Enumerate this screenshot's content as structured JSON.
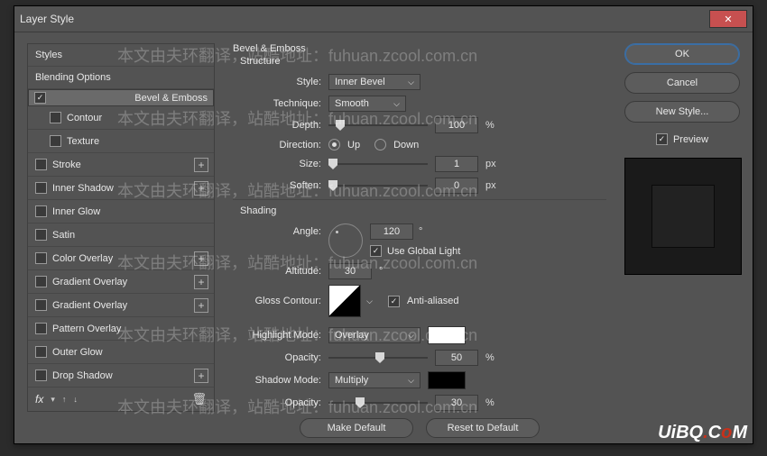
{
  "window": {
    "title": "Layer Style"
  },
  "styles": {
    "header": "Styles",
    "blending": "Blending Options",
    "bevel": "Bevel & Emboss",
    "contour": "Contour",
    "texture": "Texture",
    "stroke": "Stroke",
    "innerShadow": "Inner Shadow",
    "innerGlow": "Inner Glow",
    "satin": "Satin",
    "colorOverlay": "Color Overlay",
    "gradientOverlay": "Gradient Overlay",
    "gradientOverlay2": "Gradient Overlay",
    "patternOverlay": "Pattern Overlay",
    "outerGlow": "Outer Glow",
    "dropShadow": "Drop Shadow",
    "fx": "fx"
  },
  "panel": {
    "title": "Bevel & Emboss",
    "structure": "Structure",
    "styleLbl": "Style:",
    "styleVal": "Inner Bevel",
    "techLbl": "Technique:",
    "techVal": "Smooth",
    "depthLbl": "Depth:",
    "depthVal": "100",
    "pct": "%",
    "dirLbl": "Direction:",
    "up": "Up",
    "down": "Down",
    "sizeLbl": "Size:",
    "sizeVal": "1",
    "px": "px",
    "softenLbl": "Soften:",
    "softenVal": "0",
    "shading": "Shading",
    "angleLbl": "Angle:",
    "angleVal": "120",
    "deg": "°",
    "globalLight": "Use Global Light",
    "altLbl": "Altitude:",
    "altVal": "30",
    "glossLbl": "Gloss Contour:",
    "aa": "Anti-aliased",
    "hlModeLbl": "Highlight Mode:",
    "hlModeVal": "Overlay",
    "hlColor": "#ffffff",
    "opacityLbl": "Opacity:",
    "hlOpacity": "50",
    "shModeLbl": "Shadow Mode:",
    "shModeVal": "Multiply",
    "shColor": "#000000",
    "shOpacity": "30",
    "makeDefault": "Make Default",
    "resetDefault": "Reset to Default"
  },
  "right": {
    "ok": "OK",
    "cancel": "Cancel",
    "newStyle": "New Style...",
    "preview": "Preview"
  },
  "watermarks": {
    "t1": "本文由夫环翻译，站酷地址：fuhuan.zcool.com.cn",
    "brand": "UiBQ.CoM"
  }
}
